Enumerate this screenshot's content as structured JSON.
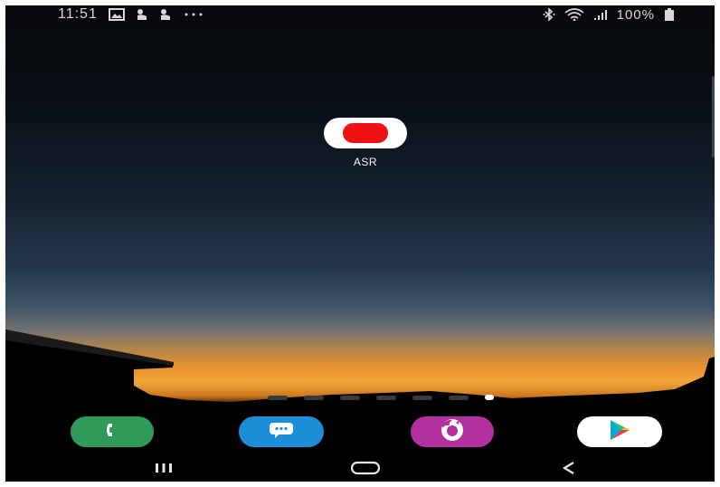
{
  "status_bar": {
    "time": "11:51",
    "left_icons": [
      "gallery-icon",
      "notification-icon",
      "notification-icon",
      "more-notifications-icon"
    ],
    "right_icons": [
      "bluetooth-icon",
      "wifi-icon",
      "signal-icon",
      "battery-icon"
    ],
    "battery_text": "100%"
  },
  "home": {
    "apps": [
      {
        "name": "asr-app",
        "label": "ASR",
        "icon": "record-icon",
        "color": "#f01212"
      }
    ]
  },
  "page_indicator": {
    "count": 7,
    "active_index": 6
  },
  "dock": {
    "apps": [
      {
        "name": "phone",
        "icon": "phone-icon",
        "color": "#2f9a5a"
      },
      {
        "name": "messages",
        "icon": "messages-icon",
        "color": "#1f8ed8"
      },
      {
        "name": "firefox",
        "icon": "firefox-icon",
        "color": "#b2319e"
      },
      {
        "name": "play-store",
        "icon": "play-store-icon",
        "color": "#ffffff"
      }
    ]
  },
  "nav_bar": {
    "buttons": [
      "recents-icon",
      "home-icon",
      "back-icon"
    ]
  }
}
